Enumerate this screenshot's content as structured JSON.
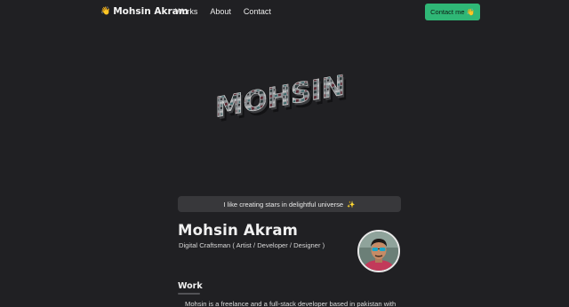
{
  "nav": {
    "logo_emoji": "👋",
    "logo_text": "Mohsin Akram",
    "links": [
      "Works",
      "About",
      "Contact"
    ],
    "contact_button": "Contact me",
    "contact_emoji": "👋"
  },
  "hero": {
    "model_text": "MOHSIN"
  },
  "greeting": {
    "text": "I like creating stars in delightful universe",
    "emoji": "✨"
  },
  "profile": {
    "name": "Mohsin Akram",
    "tagline": "Digital Craftsman ( Artist / Developer / Designer )"
  },
  "work": {
    "heading": "Work",
    "text": "Mohsin is a freelance and a full-stack developer based in pakistan with"
  },
  "colors": {
    "background": "#202023",
    "accent": "#2fb776",
    "greeting_bg": "#38383b"
  }
}
